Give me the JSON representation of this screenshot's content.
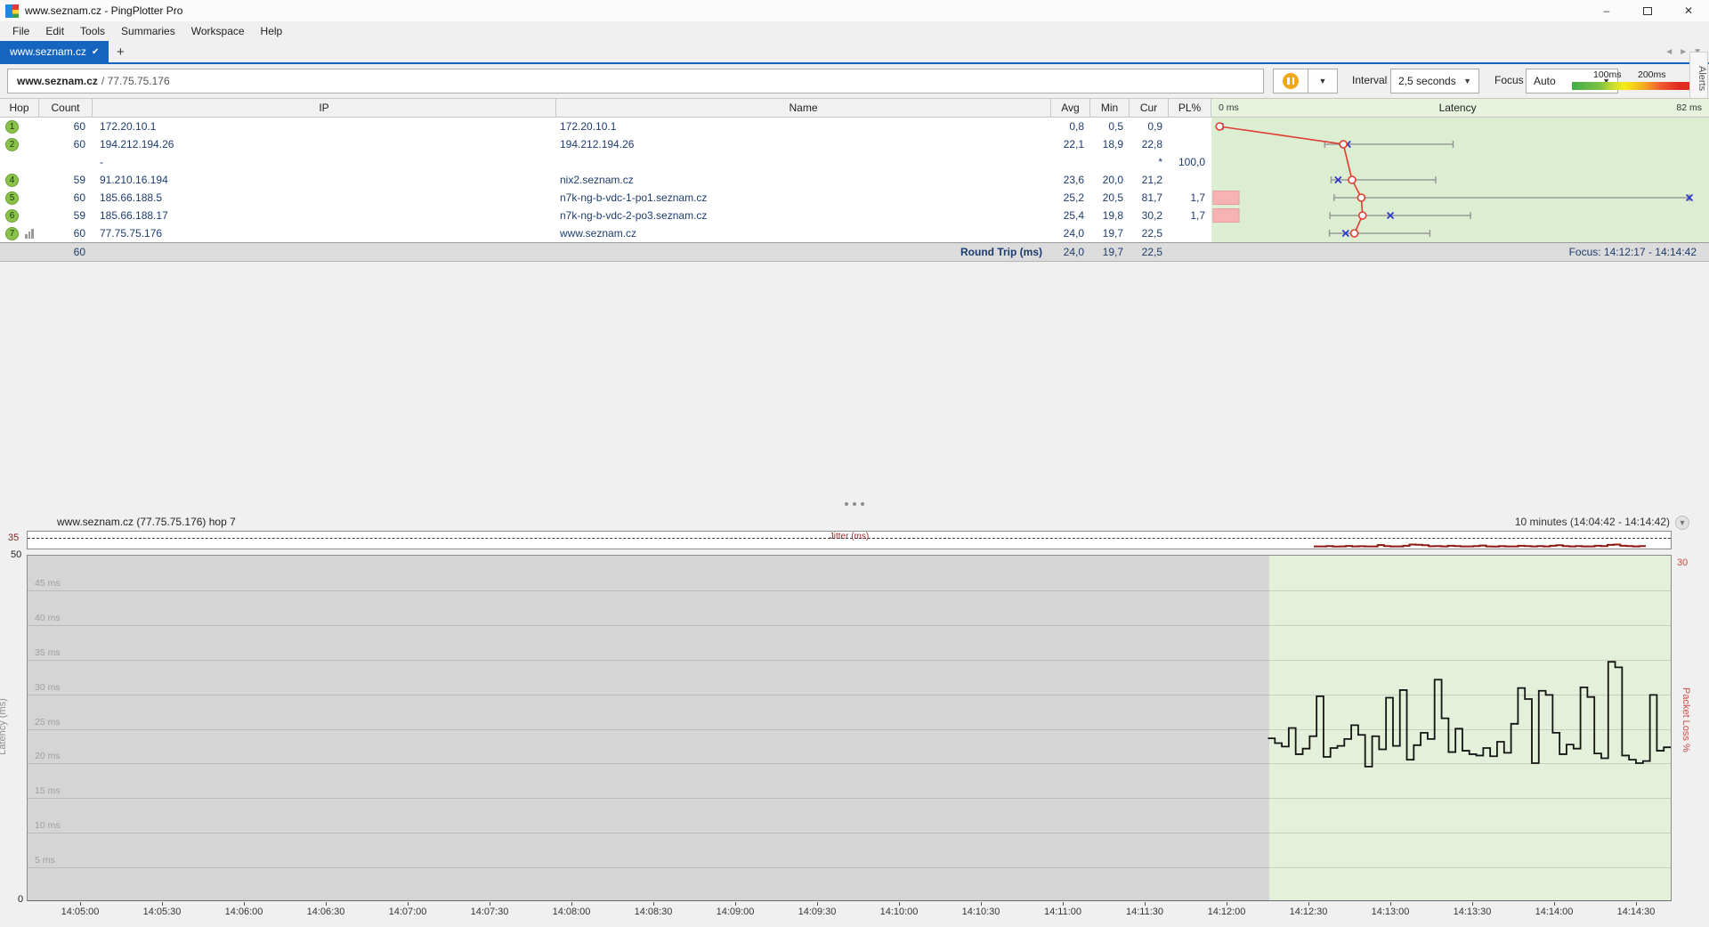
{
  "window": {
    "title": "www.seznam.cz - PingPlotter Pro"
  },
  "menu": {
    "items": [
      "File",
      "Edit",
      "Tools",
      "Summaries",
      "Workspace",
      "Help"
    ]
  },
  "tabs": {
    "active_label": "www.seznam.cz",
    "new_tab_label": "+"
  },
  "toolbar": {
    "target_host": "www.seznam.cz",
    "target_ip_suffix": "/ 77.75.75.176",
    "interval_label": "Interval",
    "interval_value": "2,5 seconds",
    "focus_label": "Focus",
    "focus_value": "Auto",
    "legend": {
      "labels": [
        "100ms",
        "200ms"
      ]
    },
    "alerts_label": "Alerts"
  },
  "trace_table": {
    "columns": [
      "Hop",
      "Count",
      "IP",
      "Name",
      "Avg",
      "Min",
      "Cur",
      "PL%"
    ],
    "latency_header": {
      "left": "0 ms",
      "center": "Latency",
      "right": "82 ms"
    },
    "rows": [
      {
        "hop": "1",
        "count": "60",
        "ip": "172.20.10.1",
        "name": "172.20.10.1",
        "avg": "0,8",
        "min": "0,5",
        "cur": "0,9",
        "pl": "",
        "pl_bar": false,
        "has_graph_icon": false
      },
      {
        "hop": "2",
        "count": "60",
        "ip": "194.212.194.26",
        "name": "194.212.194.26",
        "avg": "22,1",
        "min": "18,9",
        "cur": "22,8",
        "pl": "",
        "pl_bar": false,
        "has_graph_icon": false
      },
      {
        "hop": "",
        "count": "",
        "ip": "-",
        "name": "",
        "avg": "",
        "min": "",
        "cur": "*",
        "pl": "100,0",
        "pl_bar": false,
        "has_graph_icon": false
      },
      {
        "hop": "4",
        "count": "59",
        "ip": "91.210.16.194",
        "name": "nix2.seznam.cz",
        "avg": "23,6",
        "min": "20,0",
        "cur": "21,2",
        "pl": "",
        "pl_bar": false,
        "has_graph_icon": false
      },
      {
        "hop": "5",
        "count": "60",
        "ip": "185.66.188.5",
        "name": "n7k-ng-b-vdc-1-po1.seznam.cz",
        "avg": "25,2",
        "min": "20,5",
        "cur": "81,7",
        "pl": "1,7",
        "pl_bar": true,
        "has_graph_icon": false
      },
      {
        "hop": "6",
        "count": "59",
        "ip": "185.66.188.17",
        "name": "n7k-ng-b-vdc-2-po3.seznam.cz",
        "avg": "25,4",
        "min": "19,8",
        "cur": "30,2",
        "pl": "1,7",
        "pl_bar": true,
        "has_graph_icon": false
      },
      {
        "hop": "7",
        "count": "60",
        "ip": "77.75.75.176",
        "name": "www.seznam.cz",
        "avg": "24,0",
        "min": "19,7",
        "cur": "22,5",
        "pl": "",
        "pl_bar": false,
        "has_graph_icon": true
      }
    ],
    "footer": {
      "count": "60",
      "label": "Round Trip (ms)",
      "avg": "24,0",
      "min": "19,7",
      "cur": "22,5",
      "focus": "Focus: 14:12:17 - 14:14:42"
    }
  },
  "timeline": {
    "title": "www.seznam.cz (77.75.75.176) hop 7",
    "range_label": "10 minutes (14:04:42 - 14:14:42)",
    "jitter_label": "Jitter (ms)",
    "jitter_max": "35",
    "y_max": "50",
    "y_min": "0",
    "y_axis_title": "Latency (ms)",
    "y2_max": "30",
    "y2_axis_title": "Packet Loss %",
    "y_grid_labels": [
      "45 ms",
      "40 ms",
      "35 ms",
      "30 ms",
      "25 ms",
      "20 ms",
      "15 ms",
      "10 ms",
      "5 ms"
    ]
  },
  "chart_data": [
    {
      "id": "hop-latency-overview",
      "type": "scatter",
      "title": "Latency",
      "xlim": [
        0,
        82
      ],
      "xlabel_left": "0 ms",
      "xlabel_right": "82 ms",
      "legend_position": "none",
      "series": [
        {
          "hop": 1,
          "row": 0,
          "min": 0.5,
          "avg": 0.8,
          "cur": 0.9,
          "max": 1.2
        },
        {
          "hop": 2,
          "row": 1,
          "min": 18.9,
          "avg": 22.1,
          "cur": 22.8,
          "max": 41.0
        },
        {
          "hop": 4,
          "row": 3,
          "min": 20.0,
          "avg": 23.6,
          "cur": 21.2,
          "max": 38.0
        },
        {
          "hop": 5,
          "row": 4,
          "min": 20.5,
          "avg": 25.2,
          "cur": 81.7,
          "max": 81.7
        },
        {
          "hop": 6,
          "row": 5,
          "min": 19.8,
          "avg": 25.4,
          "cur": 30.2,
          "max": 44.0
        },
        {
          "hop": 7,
          "row": 6,
          "min": 19.7,
          "avg": 24.0,
          "cur": 22.5,
          "max": 37.0
        }
      ],
      "loss_bars": [
        {
          "row": 4,
          "pl": 1.7
        },
        {
          "row": 5,
          "pl": 1.7
        }
      ]
    },
    {
      "id": "hop7-latency-timeline",
      "type": "line",
      "title": "www.seznam.cz (77.75.75.176) hop 7",
      "ylabel": "Latency (ms)",
      "ylim": [
        0,
        50
      ],
      "y2label": "Packet Loss %",
      "y2lim": [
        0,
        30
      ],
      "grid": true,
      "x_start": "14:12:17",
      "sample_interval_s": 2.5,
      "full_window": "14:04:42 - 14:14:42",
      "focus_window": "14:12:17 - 14:14:42",
      "x_tick_labels": [
        "14:05:00",
        "14:05:30",
        "14:06:00",
        "14:06:30",
        "14:07:00",
        "14:07:30",
        "14:08:00",
        "14:08:30",
        "14:09:00",
        "14:09:30",
        "14:10:00",
        "14:10:30",
        "14:11:00",
        "14:11:30",
        "14:12:00",
        "14:12:30",
        "14:13:00",
        "14:13:30",
        "14:14:00",
        "14:14:30"
      ],
      "values_ms": [
        23.5,
        22.8,
        22.3,
        25.0,
        21.2,
        22.0,
        23.8,
        29.6,
        20.8,
        22.1,
        22.4,
        23.4,
        25.4,
        24.0,
        19.4,
        23.8,
        21.9,
        29.4,
        22.4,
        30.5,
        20.4,
        22.5,
        24.3,
        23.4,
        32.0,
        26.4,
        21.5,
        24.9,
        21.7,
        21.2,
        21.0,
        22.1,
        20.9,
        23.0,
        21.4,
        25.6,
        30.8,
        29.2,
        19.9,
        30.4,
        29.8,
        24.3,
        21.2,
        22.6,
        22.0,
        30.9,
        29.5,
        21.3,
        20.6,
        34.6,
        33.8,
        21.0,
        20.4,
        19.9,
        20.2,
        29.8,
        21.7,
        22.2
      ]
    },
    {
      "id": "hop7-jitter-strip",
      "type": "line",
      "title": "Jitter (ms)",
      "ylim": [
        0,
        35
      ],
      "values_ms": [
        7,
        7,
        8,
        6.5,
        7,
        8.5,
        7,
        7.5,
        7,
        7,
        11.5,
        8,
        7,
        7,
        9,
        13,
        12.5,
        11,
        7.5,
        8,
        7,
        9,
        8,
        7,
        7,
        8,
        10,
        7,
        6.5,
        8,
        7,
        7,
        9,
        8,
        7,
        8,
        7,
        9,
        11,
        8,
        7,
        8,
        7,
        7,
        9,
        8,
        12,
        13,
        9,
        8,
        7,
        8
      ]
    }
  ],
  "colors": {
    "accent_blue": "#1565c0",
    "hop_green": "#8bc34a",
    "latency_red": "#e03b2f",
    "cur_blue": "#2b35c8",
    "whisker_grey": "#999999",
    "loss_pink": "#f5b3b3",
    "loss_pink_border": "#e89c9c",
    "jitter_dark_red": "#8c1a11",
    "step_line": "#141414",
    "navy_text": "#1d3c6e"
  }
}
